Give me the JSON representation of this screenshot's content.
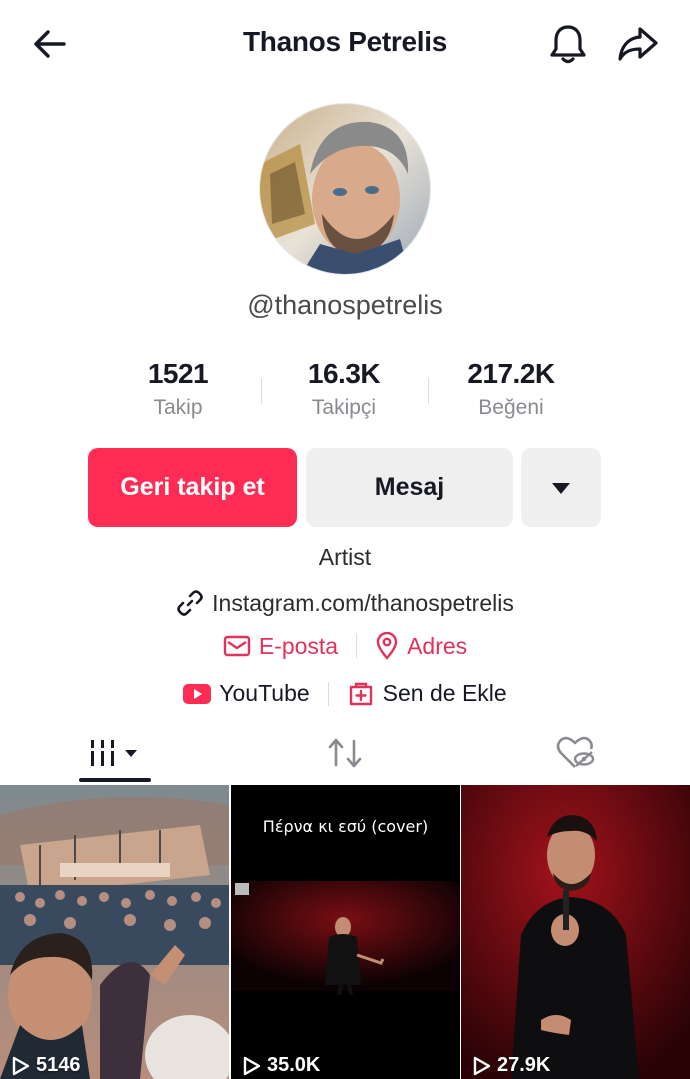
{
  "header": {
    "title": "Thanos Petrelis",
    "back_icon": "arrow-left-icon",
    "bell_icon": "bell-icon",
    "share_icon": "share-icon"
  },
  "profile": {
    "handle": "@thanospetrelis",
    "avatar_icon": "avatar"
  },
  "stats": [
    {
      "value": "1521",
      "label": "Takip"
    },
    {
      "value": "16.3K",
      "label": "Takipçi"
    },
    {
      "value": "217.2K",
      "label": "Beğeni"
    }
  ],
  "actions": {
    "follow_label": "Geri takip et",
    "message_label": "Mesaj"
  },
  "bio": {
    "text": "Artist",
    "link": "Instagram.com/thanospetrelis"
  },
  "contacts": {
    "email_label": "E-posta",
    "address_label": "Adres"
  },
  "social": {
    "youtube_label": "YouTube",
    "add_label": "Sen de Ekle"
  },
  "videos": [
    {
      "views": "5146",
      "caption": ""
    },
    {
      "views": "35.0K",
      "caption": "Πέρνα κι εσύ (cover)"
    },
    {
      "views": "27.9K",
      "caption": ""
    }
  ],
  "colors": {
    "accent": "#fe2c55",
    "link_red": "#e0325a",
    "text": "#161823",
    "muted": "#8a8b91"
  }
}
